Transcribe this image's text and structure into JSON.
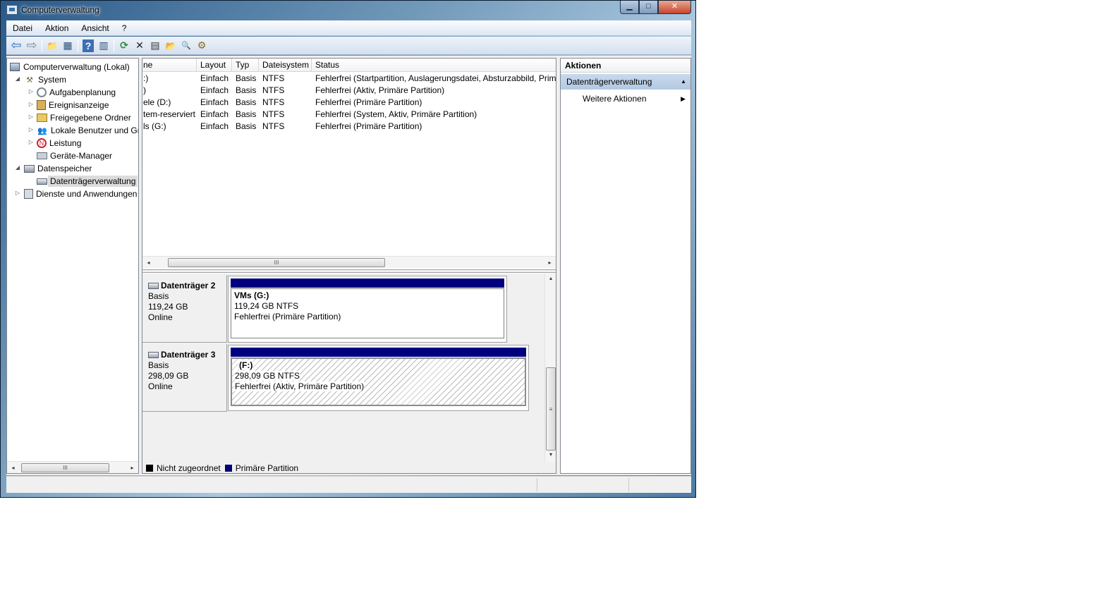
{
  "window": {
    "title": "Computerverwaltung",
    "min_icon": "minimize-icon",
    "max_icon": "maximize-icon",
    "close_icon": "close-icon",
    "min_glyph": "▁",
    "max_glyph": "□",
    "close_glyph": "✕"
  },
  "menu": [
    "Datei",
    "Aktion",
    "Ansicht",
    "?"
  ],
  "toolbar": {
    "back_icon": "back-arrow-icon",
    "back_glyph": "⇦",
    "forward_icon": "forward-arrow-icon",
    "forward_glyph": "⇨",
    "up_glyph": "📁",
    "console_glyph": "▦",
    "help_glyph": "?",
    "panel_glyph": "▥",
    "refresh_glyph": "⟳",
    "delete_glyph": "✕",
    "props_glyph": "▤",
    "open_glyph": "📂",
    "find_glyph": "🔍",
    "settings_glyph": "⚙"
  },
  "tree": {
    "root": "Computerverwaltung (Lokal)",
    "system": "System",
    "aufgaben": "Aufgabenplanung",
    "ereignis": "Ereignisanzeige",
    "freigabe": "Freigegebene Ordner",
    "benutzer": "Lokale Benutzer und Gruppen",
    "leistung": "Leistung",
    "geraete": "Geräte-Manager",
    "datenspeicher": "Datenspeicher",
    "datentraeger": "Datenträgerverwaltung",
    "dienste": "Dienste und Anwendungen",
    "expanded_glyph": "◢",
    "collapsed_glyph": "▷",
    "scroll_left": "◂",
    "scroll_right": "▸",
    "scroll_grip": "III"
  },
  "volume_list": {
    "columns": [
      "ne",
      "Layout",
      "Typ",
      "Dateisystem",
      "Status"
    ],
    "rows": [
      {
        "name": ":)",
        "layout": "Einfach",
        "typ": "Basis",
        "fs": "NTFS",
        "status": "Fehlerfrei (Startpartition, Auslagerungsdatei, Absturzabbild, Primäre Partition)"
      },
      {
        "name": ")",
        "layout": "Einfach",
        "typ": "Basis",
        "fs": "NTFS",
        "status": "Fehlerfrei (Aktiv, Primäre Partition)"
      },
      {
        "name": "ele (D:)",
        "layout": "Einfach",
        "typ": "Basis",
        "fs": "NTFS",
        "status": "Fehlerfrei (Primäre Partition)"
      },
      {
        "name": "tem-reserviert",
        "layout": "Einfach",
        "typ": "Basis",
        "fs": "NTFS",
        "status": "Fehlerfrei (System, Aktiv, Primäre Partition)"
      },
      {
        "name": "ls (G:)",
        "layout": "Einfach",
        "typ": "Basis",
        "fs": "NTFS",
        "status": "Fehlerfrei (Primäre Partition)"
      }
    ]
  },
  "disks": [
    {
      "name": "Datenträger 2",
      "type": "Basis",
      "size": "119,24 GB",
      "state": "Online",
      "volume": {
        "title": "VMs  (G:)",
        "size": "119,24 GB NTFS",
        "status": "Fehlerfrei (Primäre Partition)"
      }
    },
    {
      "name": "Datenträger 3",
      "type": "Basis",
      "size": "298,09 GB",
      "state": "Online",
      "volume": {
        "title": "(F:)",
        "size": "298,09 GB NTFS",
        "status": "Fehlerfrei (Aktiv, Primäre Partition)"
      }
    }
  ],
  "legend": [
    {
      "label": "Nicht zugeordnet",
      "color": "#000000"
    },
    {
      "label": "Primäre Partition",
      "color": "#00007f"
    }
  ],
  "actions": {
    "title": "Aktionen",
    "section": "Datenträgerverwaltung",
    "section_glyph": "▲",
    "item": "Weitere Aktionen",
    "item_glyph": "▶"
  },
  "vscroll": {
    "up": "▴",
    "down": "▾",
    "grip": "≡"
  }
}
